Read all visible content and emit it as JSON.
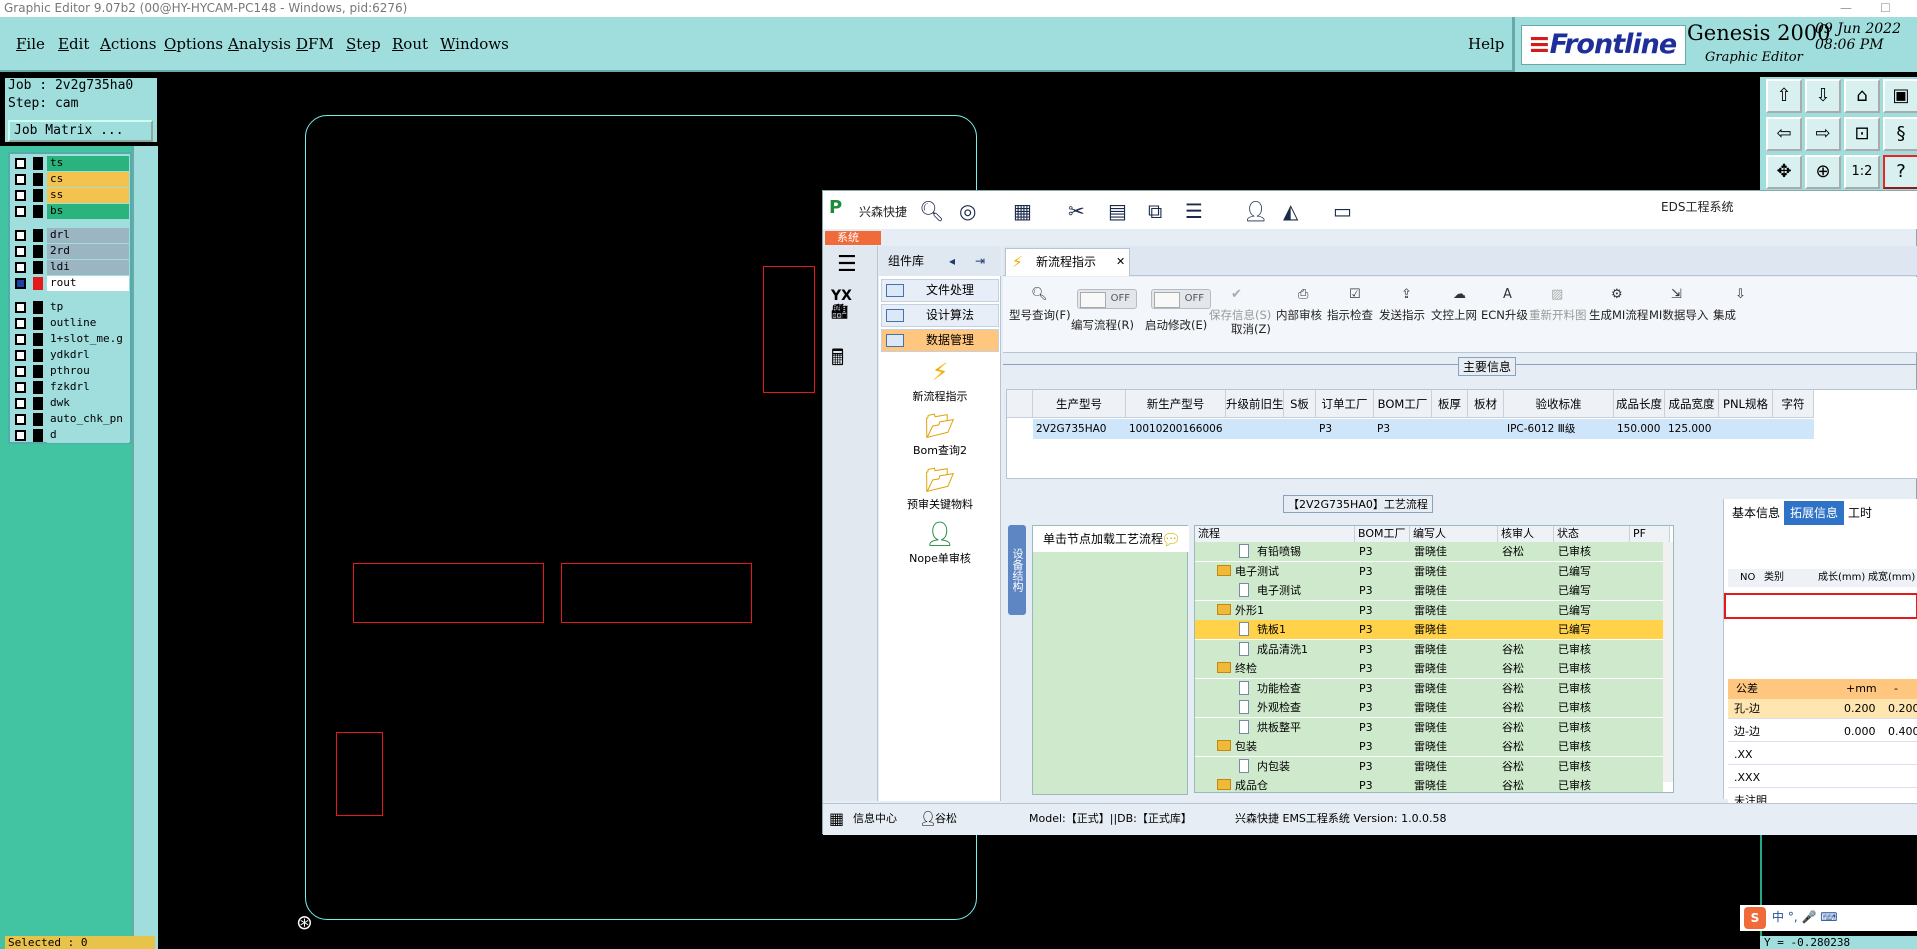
{
  "window_title": "Graphic Editor 9.07b2 (00@HY-HYCAM-PC148 - Windows, pid:6276)",
  "menu": [
    {
      "key": "F",
      "rest": "ile"
    },
    {
      "key": "E",
      "rest": "dit"
    },
    {
      "key": "A",
      "rest": "ctions"
    },
    {
      "key": "O",
      "rest": "ptions"
    },
    {
      "key": "A",
      "rest": "nalysis"
    },
    {
      "key": "D",
      "rest": "FM"
    },
    {
      "key": "S",
      "rest": "tep"
    },
    {
      "key": "R",
      "rest": "out"
    },
    {
      "key": "W",
      "rest": "indows"
    }
  ],
  "help": "Help",
  "brand": {
    "frontline": "Frontline",
    "genesis": "Genesis 2000",
    "editor": "Graphic Editor",
    "date": "09 Jun 2022",
    "time": "08:06 PM"
  },
  "job": {
    "job_line": "Job : 2v2g735ha0",
    "step_line": "Step: cam",
    "matrix": "Job Matrix ..."
  },
  "layers": [
    {
      "name": "ts",
      "color": "#2bb37e"
    },
    {
      "name": "cs",
      "color": "#f4c34e"
    },
    {
      "name": "ss",
      "color": "#f4c34e"
    },
    {
      "name": "bs",
      "color": "#2bb37e"
    },
    {
      "name": "drl",
      "color": "#9bb5c2"
    },
    {
      "name": "2rd",
      "color": "#9bb5c2"
    },
    {
      "name": "ldi",
      "color": "#9bb5c2"
    },
    {
      "name": "rout",
      "color": "#ffffff"
    },
    {
      "name": "tp",
      "color": "#9fdedd"
    },
    {
      "name": "outline",
      "color": "#9fdedd"
    },
    {
      "name": "1+slot_me.g",
      "color": "#9fdedd"
    },
    {
      "name": "ydkdrl",
      "color": "#9fdedd"
    },
    {
      "name": "pthrou",
      "color": "#9fdedd"
    },
    {
      "name": "fzkdrl",
      "color": "#9fdedd"
    },
    {
      "name": "dwk",
      "color": "#9fdedd"
    },
    {
      "name": "auto_chk_pn",
      "color": "#9fdedd"
    },
    {
      "name": "d",
      "color": "#9fdedd"
    }
  ],
  "selected": "Selected : 0",
  "coord": "Y = -0.280238",
  "eds": {
    "app_name": "兴森快捷",
    "caption": "EDS工程系统",
    "sys_tab": "系统",
    "comp_header": "组件库",
    "comp_items": [
      "文件处理",
      "设计算法",
      "数据管理"
    ],
    "tools": [
      "新流程指示",
      "Bom查询2",
      "预审关键物料",
      "Nope单审核"
    ],
    "tab_label": "新流程指示",
    "ribbon": [
      {
        "label": "型号查询(F)",
        "icon": "search-icon",
        "dim": false
      },
      {
        "label": "编写流程(R)",
        "icon": "toggle",
        "dim": false
      },
      {
        "label": "启动修改(E)",
        "icon": "toggle",
        "dim": false
      },
      {
        "label": "保存信息(S)",
        "icon": "check-icon",
        "dim": true
      },
      {
        "label": "内部审核",
        "icon": "print-icon",
        "dim": false
      },
      {
        "label": "指示检查",
        "icon": "checkbox-icon",
        "dim": false
      },
      {
        "label": "发送指示",
        "icon": "upload-icon",
        "dim": false
      },
      {
        "label": "文控上网",
        "icon": "cloud-upload-icon",
        "dim": false
      },
      {
        "label": "ECN升级",
        "icon": "ecn-icon",
        "dim": false
      },
      {
        "label": "重新开料图",
        "icon": "image-icon",
        "dim": true
      },
      {
        "label": "生成MI流程",
        "icon": "gears-icon",
        "dim": false
      },
      {
        "label": "MI数据导入",
        "icon": "import-icon",
        "dim": false
      },
      {
        "label": "集成",
        "icon": "download-icon",
        "dim": false
      }
    ],
    "cancel_label": "取消(Z)",
    "toggle_off": "OFF",
    "main_info_title": "主要信息",
    "main_columns": [
      "生产型号",
      "新生产型号",
      "升级前旧生产型号",
      "S板",
      "订单工厂",
      "BOM工厂",
      "板厚",
      "板材",
      "验收标准",
      "成品长度",
      "成品宽度",
      "PNL规格",
      "字符"
    ],
    "main_row": [
      "2V2G735HA0",
      "10010200166006",
      "",
      "",
      "P3",
      "P3",
      "",
      "",
      "IPC-6012 Ⅲ级",
      "150.000",
      "125.000",
      "",
      ""
    ],
    "flow_title": "【2V2G735HA0】工艺流程",
    "vtab": "设备结构",
    "load_hint": "单击节点加载工艺流程",
    "flow_columns": [
      "流程",
      "BOM工厂",
      "编写人",
      "核审人",
      "状态",
      "PF"
    ],
    "flow_rows": [
      {
        "indent": 2,
        "type": "doc",
        "name": "有铅喷锡",
        "bom": "P3",
        "writer": "雷晓佳",
        "checker": "谷松",
        "status": "已审核",
        "sel": false
      },
      {
        "indent": 1,
        "type": "folder",
        "name": "电子测试",
        "bom": "P3",
        "writer": "雷晓佳",
        "checker": "",
        "status": "已编写",
        "sel": false
      },
      {
        "indent": 2,
        "type": "doc",
        "name": "电子测试",
        "bom": "P3",
        "writer": "雷晓佳",
        "checker": "",
        "status": "已编写",
        "sel": false
      },
      {
        "indent": 1,
        "type": "folder",
        "name": "外形1",
        "bom": "P3",
        "writer": "雷晓佳",
        "checker": "",
        "status": "已编写",
        "sel": false
      },
      {
        "indent": 2,
        "type": "doc",
        "name": "铣板1",
        "bom": "P3",
        "writer": "雷晓佳",
        "checker": "",
        "status": "已编写",
        "sel": true
      },
      {
        "indent": 2,
        "type": "doc",
        "name": "成品清洗1",
        "bom": "P3",
        "writer": "雷晓佳",
        "checker": "谷松",
        "status": "已审核",
        "sel": false
      },
      {
        "indent": 1,
        "type": "folder",
        "name": "终检",
        "bom": "P3",
        "writer": "雷晓佳",
        "checker": "谷松",
        "status": "已审核",
        "sel": false
      },
      {
        "indent": 2,
        "type": "doc",
        "name": "功能检查",
        "bom": "P3",
        "writer": "雷晓佳",
        "checker": "谷松",
        "status": "已审核",
        "sel": false
      },
      {
        "indent": 2,
        "type": "doc",
        "name": "外观检查",
        "bom": "P3",
        "writer": "雷晓佳",
        "checker": "谷松",
        "status": "已审核",
        "sel": false
      },
      {
        "indent": 2,
        "type": "doc",
        "name": "烘板整平",
        "bom": "P3",
        "writer": "雷晓佳",
        "checker": "谷松",
        "status": "已审核",
        "sel": false
      },
      {
        "indent": 1,
        "type": "folder",
        "name": "包装",
        "bom": "P3",
        "writer": "雷晓佳",
        "checker": "谷松",
        "status": "已审核",
        "sel": false
      },
      {
        "indent": 2,
        "type": "doc",
        "name": "内包装",
        "bom": "P3",
        "writer": "雷晓佳",
        "checker": "谷松",
        "status": "已审核",
        "sel": false
      },
      {
        "indent": 1,
        "type": "folder",
        "name": "成品仓",
        "bom": "P3",
        "writer": "雷晓佳",
        "checker": "谷松",
        "status": "已审核",
        "sel": false
      }
    ],
    "right_tabs": [
      "基本信息",
      "拓展信息",
      "工时"
    ],
    "right_cols": [
      "NO",
      "类别",
      "成长(mm)",
      "成宽(mm)"
    ],
    "tol_header": [
      "公差",
      "+mm",
      "-mm"
    ],
    "tol_rows": [
      {
        "name": "孔-边",
        "plus": "0.200",
        "minus": "0.200"
      },
      {
        "name": "边-边",
        "plus": "0.000",
        "minus": "0.400"
      },
      {
        "name": ".XX",
        "plus": "",
        "minus": ""
      },
      {
        "name": ".XXX",
        "plus": "",
        "minus": ""
      },
      {
        "name": "未注明",
        "plus": "",
        "minus": ""
      }
    ],
    "status": {
      "info_center": "信息中心",
      "user": "谷松",
      "model": "Model:【正式】||DB:【正式库】",
      "version": "兴森快捷 EMS工程系统 Version: 1.0.0.58"
    }
  },
  "ime": "中 °, 🎤 ⌨"
}
